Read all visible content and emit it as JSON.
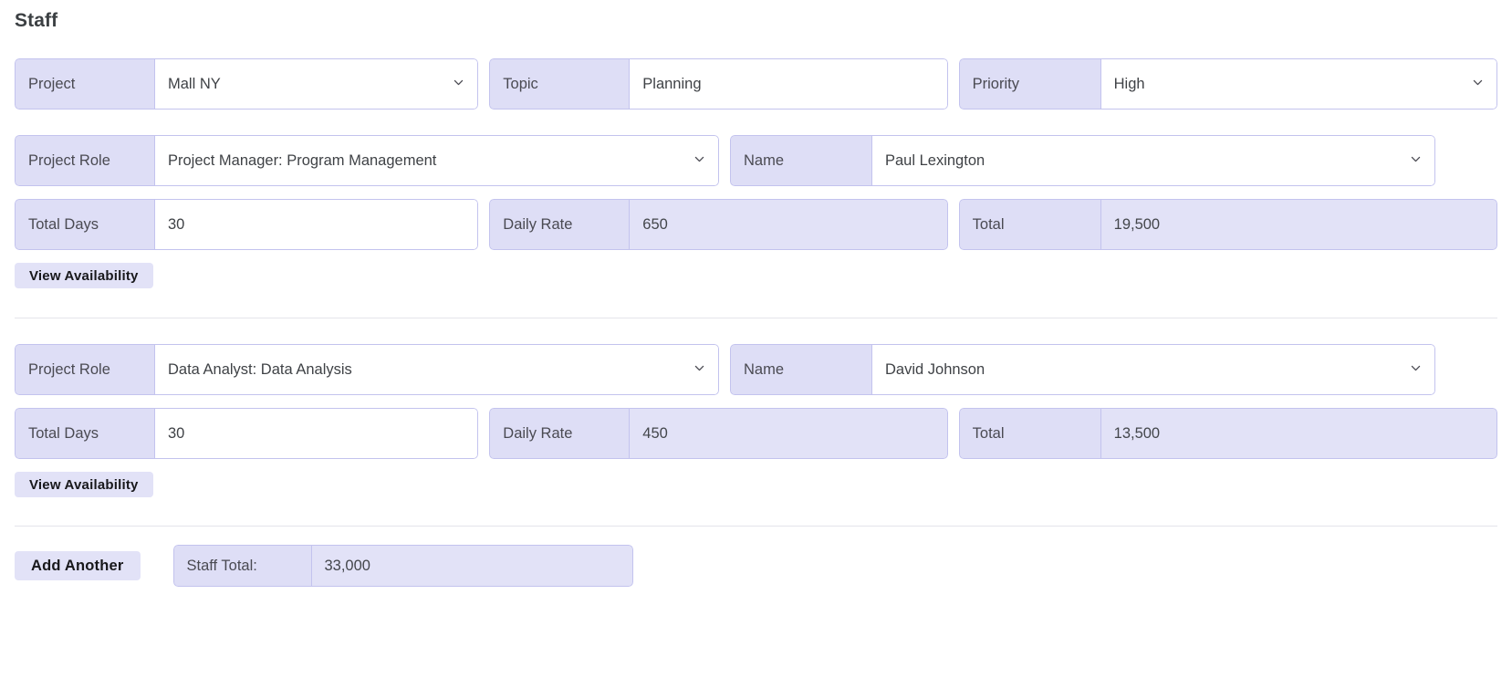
{
  "page": {
    "title": "Staff"
  },
  "header_row": {
    "project": {
      "label": "Project",
      "value": "Mall NY",
      "control": "select",
      "icon": "chevron-down-icon"
    },
    "topic": {
      "label": "Topic",
      "value": "Planning",
      "control": "text"
    },
    "priority": {
      "label": "Priority",
      "value": "High",
      "control": "select",
      "icon": "chevron-down-icon"
    }
  },
  "staff_rows": [
    {
      "project_role": {
        "label": "Project Role",
        "value": "Project Manager: Program Management",
        "control": "select"
      },
      "name": {
        "label": "Name",
        "value": "Paul Lexington",
        "control": "select"
      },
      "total_days": {
        "label": "Total Days",
        "value": "30",
        "control": "text"
      },
      "daily_rate": {
        "label": "Daily Rate",
        "value": "650",
        "control": "readonly"
      },
      "total": {
        "label": "Total",
        "value": "19,500",
        "control": "readonly"
      },
      "availability_button": "View Availability"
    },
    {
      "project_role": {
        "label": "Project Role",
        "value": "Data Analyst: Data Analysis",
        "control": "select"
      },
      "name": {
        "label": "Name",
        "value": "David Johnson",
        "control": "select"
      },
      "total_days": {
        "label": "Total Days",
        "value": "30",
        "control": "text"
      },
      "daily_rate": {
        "label": "Daily Rate",
        "value": "450",
        "control": "readonly"
      },
      "total": {
        "label": "Total",
        "value": "13,500",
        "control": "readonly"
      },
      "availability_button": "View Availability"
    }
  ],
  "footer": {
    "add_another_label": "Add Another",
    "staff_total": {
      "label": "Staff Total:",
      "value": "33,000"
    }
  },
  "colors": {
    "accent_fill": "#dedef6",
    "accent_border": "#c3c3ee",
    "readonly_fill": "#e2e2f7",
    "text": "#3c4043",
    "divider": "#e4e4ea"
  }
}
